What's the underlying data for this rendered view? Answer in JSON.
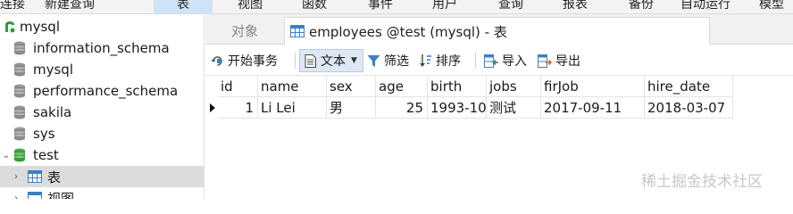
{
  "menubar": {
    "items": [
      "连接",
      "新建查询",
      "表",
      "视图",
      "函数",
      "事件",
      "用户",
      "查询",
      "报表",
      "备份",
      "自动运行",
      "模型"
    ]
  },
  "sidebar": {
    "connection": "mysql",
    "databases": [
      "information_schema",
      "mysql",
      "performance_schema",
      "sakila",
      "sys",
      "test"
    ],
    "test_children": [
      "表",
      "视图"
    ]
  },
  "tabs": {
    "objects_label": "对象",
    "active_label": "employees @test (mysql) - 表"
  },
  "toolbar": {
    "begin_transaction": "开始事务",
    "text": "文本",
    "filter": "筛选",
    "sort": "排序",
    "import": "导入",
    "export": "导出"
  },
  "table": {
    "columns": [
      "id",
      "name",
      "sex",
      "age",
      "birth",
      "jobs",
      "firJob",
      "hire_date"
    ],
    "rows": [
      [
        "1",
        "Li Lei",
        "男",
        "25",
        "1993-10-",
        "测试",
        "2017-09-11",
        "2018-03-07"
      ]
    ]
  },
  "watermark": "稀土掘金技术社区",
  "colors": {
    "accent_selected": "#cfe3f7",
    "db_icon": "#909090",
    "db_icon_active": "#3a9a3a",
    "connection_icon": "#2e9e3e"
  }
}
